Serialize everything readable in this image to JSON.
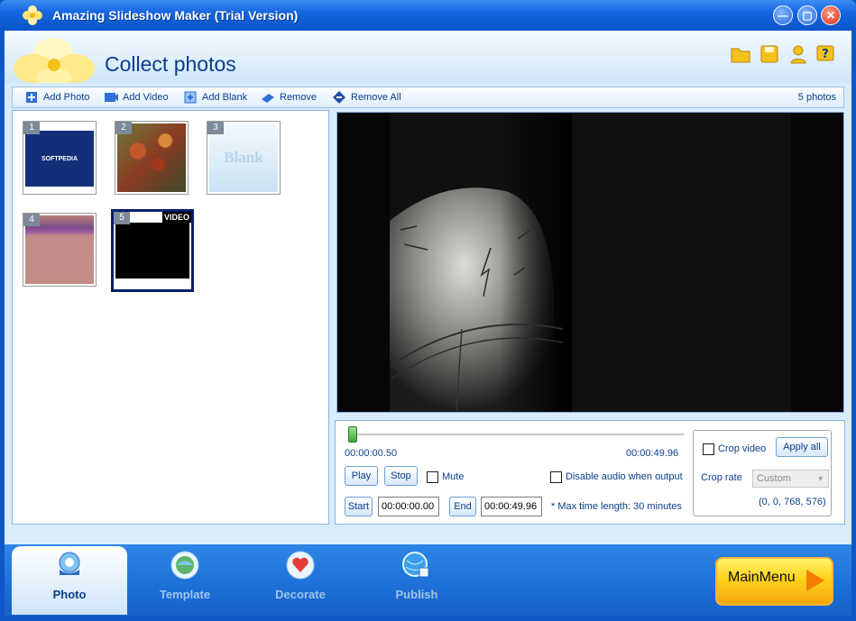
{
  "window": {
    "title": "Amazing Slideshow Maker (Trial Version)"
  },
  "header": {
    "title": "Collect photos"
  },
  "toolbar": {
    "add_photo": "Add Photo",
    "add_video": "Add Video",
    "add_blank": "Add Blank",
    "remove": "Remove",
    "remove_all": "Remove All",
    "count": "5 photos"
  },
  "thumbnails": [
    {
      "num": "1",
      "kind": "photo",
      "text": "SOFTPEDIA"
    },
    {
      "num": "2",
      "kind": "photo"
    },
    {
      "num": "3",
      "kind": "blank",
      "text": "Blank"
    },
    {
      "num": "4",
      "kind": "photo"
    },
    {
      "num": "5",
      "kind": "video",
      "tag": "VIDEO",
      "selected": true
    }
  ],
  "controls": {
    "current_time": "00:00:00.50",
    "total_time": "00:00:49.96",
    "progress": 0.01,
    "play": "Play",
    "stop": "Stop",
    "mute": "Mute",
    "disable_audio": "Disable audio when output",
    "start": "Start",
    "start_value": "00:00:00.00",
    "end": "End",
    "end_value": "00:00:49.96",
    "max_time": "* Max time length: 30 minutes"
  },
  "crop": {
    "crop_video": "Crop video",
    "apply_all": "Apply all",
    "crop_rate": "Crop rate",
    "rate_value": "Custom",
    "rect": "(0, 0, 768, 576)"
  },
  "bottom": {
    "tabs": [
      "Photo",
      "Template",
      "Decorate",
      "Publish"
    ],
    "active": "Photo",
    "main_menu": "MainMenu"
  }
}
